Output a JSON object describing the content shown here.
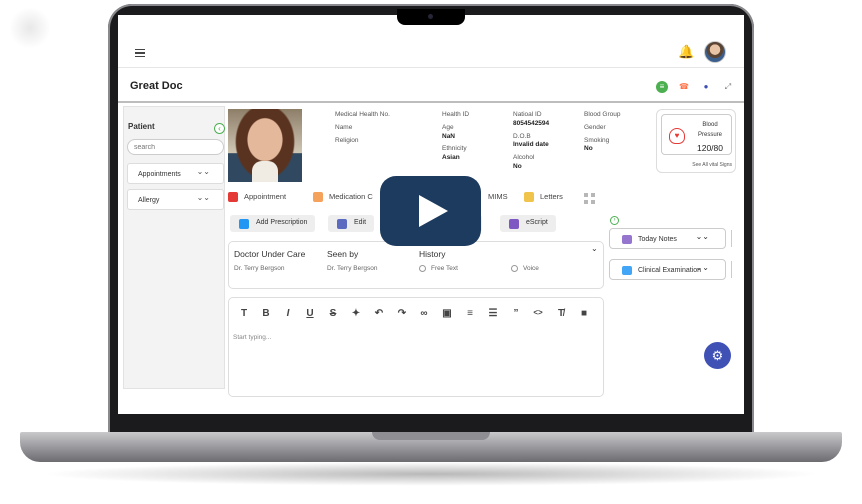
{
  "app": {
    "title": "Great Doc"
  },
  "sidebar": {
    "title": "Patient",
    "search_placeholder": "search",
    "items": [
      {
        "label": "Appointments"
      },
      {
        "label": "Allergy"
      }
    ]
  },
  "patient_info": {
    "col1": {
      "label1": "Medical Health No.",
      "label2": "Name",
      "label3": "Religion"
    },
    "col2": {
      "health_id_label": "Health ID",
      "age_label": "Age",
      "age_value": "NaN",
      "ethnicity_label": "Ethnicity",
      "ethnicity_value": "Asian"
    },
    "col3": {
      "national_id_label": "Natioal ID",
      "national_id_value": "8054542594",
      "dob_label": "D.O.B",
      "dob_value": "Invalid date",
      "alcohol_label": "Alcohol",
      "alcohol_value": "No"
    },
    "col4": {
      "blood_group_label": "Blood Group",
      "gender_label": "Gender",
      "smoking_label": "Smoking",
      "smoking_value": "No"
    }
  },
  "vitals": {
    "label_line1": "Blood",
    "label_line2": "Pressure",
    "value": "120/80",
    "see_all": "See All vital Signs"
  },
  "tabs": [
    {
      "label": "Appointment"
    },
    {
      "label": "Medication C"
    },
    {
      "label": "MIMS"
    },
    {
      "label": "Letters"
    }
  ],
  "actions": [
    {
      "label": "Add Prescription"
    },
    {
      "label": "Edit"
    },
    {
      "label": "t"
    },
    {
      "label": "eScript"
    }
  ],
  "doctor": {
    "care_header": "Doctor Under Care",
    "care_value": "Dr. Terry Bergson",
    "seen_header": "Seen by",
    "seen_value": "Dr. Terry Bergson",
    "history_header": "History",
    "history_options": [
      {
        "label": "Free Text"
      },
      {
        "label": "Voice"
      }
    ]
  },
  "editor": {
    "placeholder": "Start typing...",
    "tools": [
      "T",
      "B",
      "I",
      "U",
      "S",
      "✦",
      "↶",
      "↷",
      "∞",
      "▣",
      "≡",
      "☰",
      "”",
      "<>",
      "T̸",
      "■"
    ]
  },
  "side_panels": [
    {
      "label": "Today Notes"
    },
    {
      "label": "Clinical Examination"
    }
  ],
  "colors": {
    "accent": "#3f51b5",
    "play": "#1d3b5e",
    "ok": "#4caf50",
    "alert": "#e53935"
  }
}
